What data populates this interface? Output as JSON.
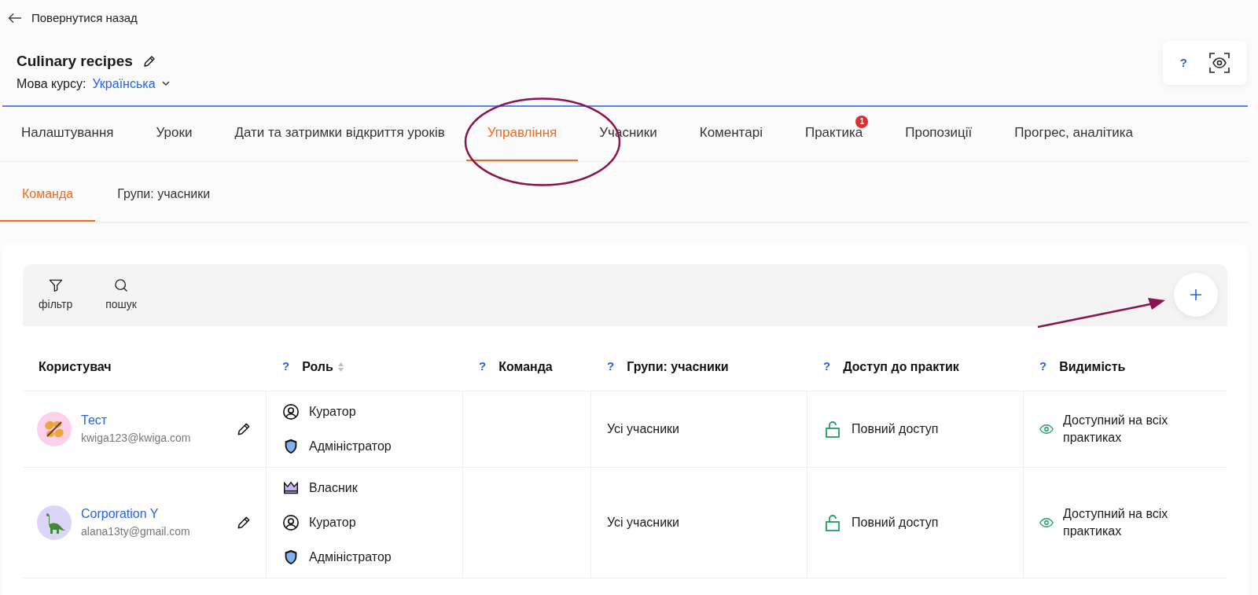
{
  "back_link": "Повернутися назад",
  "course": {
    "title": "Culinary recipes",
    "language_label": "Мова курсу:",
    "language": "Українська"
  },
  "help_panel": {
    "help": "?"
  },
  "tabs": [
    {
      "label": "Налаштування",
      "selected": false
    },
    {
      "label": "Уроки",
      "selected": false
    },
    {
      "label": "Дати та затримки відкриття уроків",
      "selected": false
    },
    {
      "label": "Управління",
      "selected": true
    },
    {
      "label": "Учасники",
      "selected": false
    },
    {
      "label": "Коментарі",
      "selected": false
    },
    {
      "label": "Практика",
      "selected": false,
      "badge": "1"
    },
    {
      "label": "Пропозиції",
      "selected": false
    },
    {
      "label": "Прогрес, аналітика",
      "selected": false
    }
  ],
  "subtabs": [
    {
      "label": "Команда",
      "selected": true
    },
    {
      "label": "Групи: учасники",
      "selected": false
    }
  ],
  "toolbar": {
    "filter": "фільтр",
    "search": "пошук"
  },
  "table": {
    "columns": [
      {
        "label": "Користувач",
        "sortable": false
      },
      {
        "label": "Роль",
        "help_mark": "?",
        "sortable": true
      },
      {
        "label": "Команда",
        "help_mark": "?",
        "sortable": false
      },
      {
        "label": "Групи: учасники",
        "help_mark": "?",
        "sortable": false
      },
      {
        "label": "Доступ до практик",
        "help_mark": "?",
        "sortable": false
      },
      {
        "label": "Видимість",
        "help_mark": "?",
        "sortable": false
      }
    ],
    "rows": [
      {
        "name": "Тест",
        "email": "kwiga123@kwiga.com",
        "avatar": {
          "kind": "butterfly"
        },
        "roles": [
          {
            "kind": "curator",
            "label": "Куратор"
          },
          {
            "kind": "admin",
            "label": "Адміністратор"
          }
        ],
        "groups": "Усі учасники",
        "access": "Повний доступ",
        "visibility": "Доступний на всіх практиках"
      },
      {
        "name": "Corporation Y",
        "email": "alana13ty@gmail.com",
        "avatar": {
          "kind": "dinosaur"
        },
        "roles": [
          {
            "kind": "owner",
            "label": "Власник"
          },
          {
            "kind": "curator",
            "label": "Куратор"
          },
          {
            "kind": "admin",
            "label": "Адміністратор"
          }
        ],
        "groups": "Усі учасники",
        "access": "Повний доступ",
        "visibility": "Доступний на всіх практиках"
      }
    ]
  }
}
